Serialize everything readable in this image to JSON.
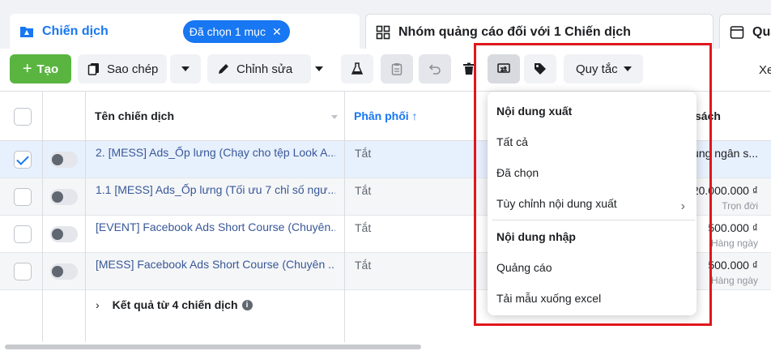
{
  "tabs": {
    "campaigns": "Chiến dịch",
    "selected_chip": "Đã chọn 1 mục",
    "adsets": "Nhóm quảng cáo đối với 1 Chiến dịch",
    "ads": "Quả"
  },
  "toolbar": {
    "create": "Tạo",
    "copy": "Sao chép",
    "edit": "Chỉnh sửa",
    "rules": "Quy tắc",
    "view": "Xe"
  },
  "table": {
    "headers": {
      "name": "Tên chiến dịch",
      "delivery": "Phân phối ↑",
      "budget": "sách"
    },
    "rows": [
      {
        "name": "2. [MESS] Ads_Ốp lưng (Chạy cho tệp Look A...",
        "delivery": "Tắt",
        "budget": "ung ngân s...",
        "budget_sub": ""
      },
      {
        "name": "1.1 [MESS] Ads_Ốp lưng (Tối ưu 7 chỉ số ngư...",
        "delivery": "Tắt",
        "budget": "20.000.000 ₫",
        "budget_sub": "Trọn đời"
      },
      {
        "name": "[EVENT] Facebook Ads Short Course (Chuyên...",
        "delivery": "Tắt",
        "budget": "500.000 ₫",
        "budget_sub": "Hàng ngày"
      },
      {
        "name": "[MESS] Facebook Ads Short Course (Chuyên ...",
        "delivery": "Tắt",
        "budget": "500.000 ₫",
        "budget_sub": "Hàng ngày"
      }
    ],
    "summary": "Kết quả từ 4 chiến dịch"
  },
  "menu": {
    "export_header": "Nội dung xuất",
    "all": "Tất cả",
    "selected": "Đã chọn",
    "custom_export": "Tùy chỉnh nội dung xuất",
    "import_header": "Nội dung nhập",
    "ads": "Quảng cáo",
    "download_template": "Tải mẫu xuống excel"
  },
  "colors": {
    "accent": "#1877f2",
    "create_button": "#5ab540",
    "highlight": "#e0171c"
  }
}
